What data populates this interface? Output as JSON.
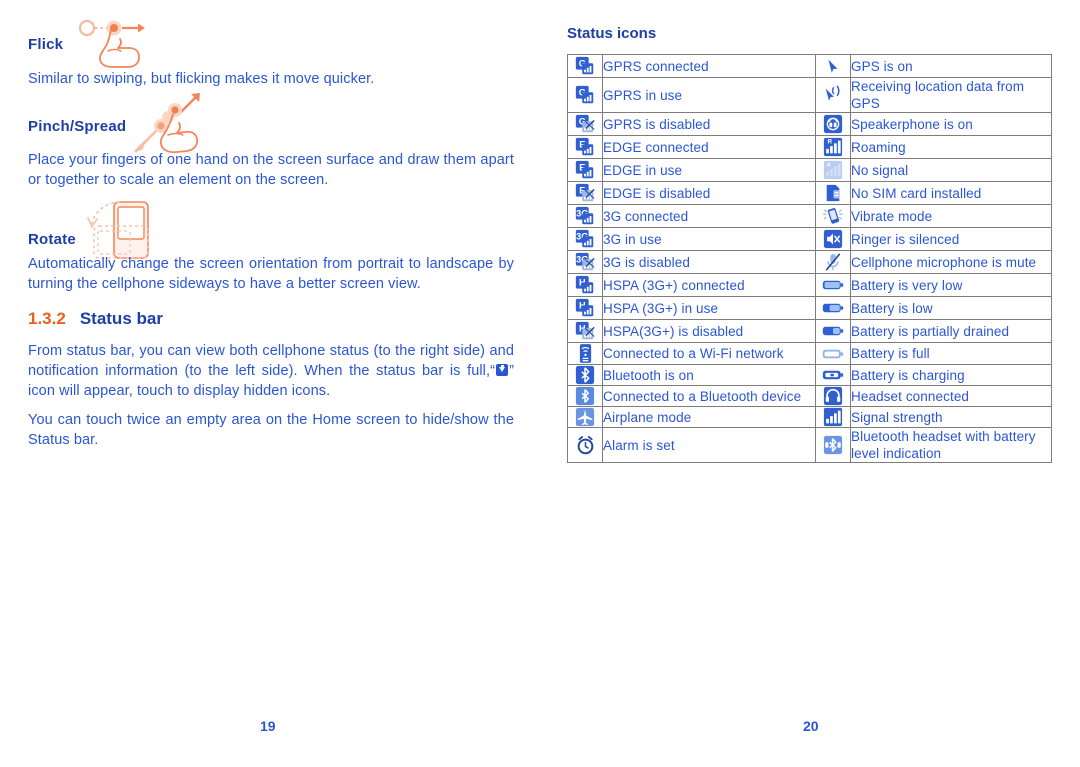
{
  "colors": {
    "heading_blue": "#1d3fa5",
    "body_blue": "#2a56d6",
    "accent_orange": "#e8601c",
    "icon_blue": "#2f5fd0",
    "table_border": "#7d7d7d"
  },
  "left_page": {
    "page_number": "19",
    "gestures": [
      {
        "heading": "Flick",
        "description": "Similar to swiping, but flicking makes it move quicker.",
        "illustration": "flick-hand-icon"
      },
      {
        "heading": "Pinch/Spread",
        "description": "Place your fingers of one hand on the screen surface and draw them apart or together to scale an element on the screen.",
        "illustration": "pinch-spread-hand-icon"
      },
      {
        "heading": "Rotate",
        "description": "Automatically change the screen orientation from portrait to landscape by turning the cellphone sideways to have a better screen view.",
        "illustration": "rotate-phone-icon"
      }
    ],
    "section": {
      "number": "1.3.2",
      "title": "Status bar",
      "paragraph_1_before": "From status bar, you can view both cellphone status (to the right side) and notification information (to the left side). When the status bar is full,“",
      "paragraph_1_after": "” icon will appear, touch to display hidden icons.",
      "inline_icon_name": "more-notifications-icon",
      "paragraph_2": "You can touch twice an empty area on the Home screen to hide/show the Status bar."
    }
  },
  "right_page": {
    "page_number": "20",
    "table_title": "Status icons",
    "rows": [
      {
        "left_icon": "gprs-connected-icon",
        "left_label": "GPRS connected",
        "right_icon": "gps-on-icon",
        "right_label": "GPS is on"
      },
      {
        "left_icon": "gprs-in-use-icon",
        "left_label": "GPRS in use",
        "right_icon": "gps-receiving-icon",
        "right_label": "Receiving location data from GPS"
      },
      {
        "left_icon": "gprs-disabled-icon",
        "left_label": "GPRS is disabled",
        "right_icon": "speakerphone-icon",
        "right_label": "Speakerphone is on"
      },
      {
        "left_icon": "edge-connected-icon",
        "left_label": "EDGE connected",
        "right_icon": "roaming-icon",
        "right_label": "Roaming"
      },
      {
        "left_icon": "edge-in-use-icon",
        "left_label": "EDGE in use",
        "right_icon": "no-signal-icon",
        "right_label": "No signal"
      },
      {
        "left_icon": "edge-disabled-icon",
        "left_label": "EDGE is disabled",
        "right_icon": "no-sim-card-icon",
        "right_label": "No SIM card installed"
      },
      {
        "left_icon": "3g-connected-icon",
        "left_label": "3G connected",
        "right_icon": "vibrate-mode-icon",
        "right_label": "Vibrate mode"
      },
      {
        "left_icon": "3g-in-use-icon",
        "left_label": "3G in use",
        "right_icon": "ringer-silenced-icon",
        "right_label": "Ringer is silenced"
      },
      {
        "left_icon": "3g-disabled-icon",
        "left_label": "3G is disabled",
        "right_icon": "microphone-mute-icon",
        "right_label": "Cellphone microphone is mute"
      },
      {
        "left_icon": "hspa-connected-icon",
        "left_label": "HSPA (3G+) connected",
        "right_icon": "battery-very-low-icon",
        "right_label": "Battery is very low"
      },
      {
        "left_icon": "hspa-in-use-icon",
        "left_label": "HSPA (3G+) in use",
        "right_icon": "battery-low-icon",
        "right_label": "Battery is low"
      },
      {
        "left_icon": "hspa-disabled-icon",
        "left_label": "HSPA(3G+) is disabled",
        "right_icon": "battery-partial-icon",
        "right_label": "Battery is partially drained"
      },
      {
        "left_icon": "wifi-connected-icon",
        "left_label": "Connected to a Wi-Fi network",
        "right_icon": "battery-full-icon",
        "right_label": "Battery is full"
      },
      {
        "left_icon": "bluetooth-on-icon",
        "left_label": "Bluetooth is on",
        "right_icon": "battery-charging-icon",
        "right_label": "Battery is charging"
      },
      {
        "left_icon": "bluetooth-connected-icon",
        "left_label": "Connected to a Bluetooth device",
        "right_icon": "headset-connected-icon",
        "right_label": "Headset connected"
      },
      {
        "left_icon": "airplane-mode-icon",
        "left_label": "Airplane mode",
        "right_icon": "signal-strength-icon",
        "right_label": "Signal strength"
      },
      {
        "left_icon": "alarm-set-icon",
        "left_label": "Alarm is set",
        "right_icon": "bluetooth-headset-battery-icon",
        "right_label": "Bluetooth headset with battery level indication"
      }
    ]
  }
}
